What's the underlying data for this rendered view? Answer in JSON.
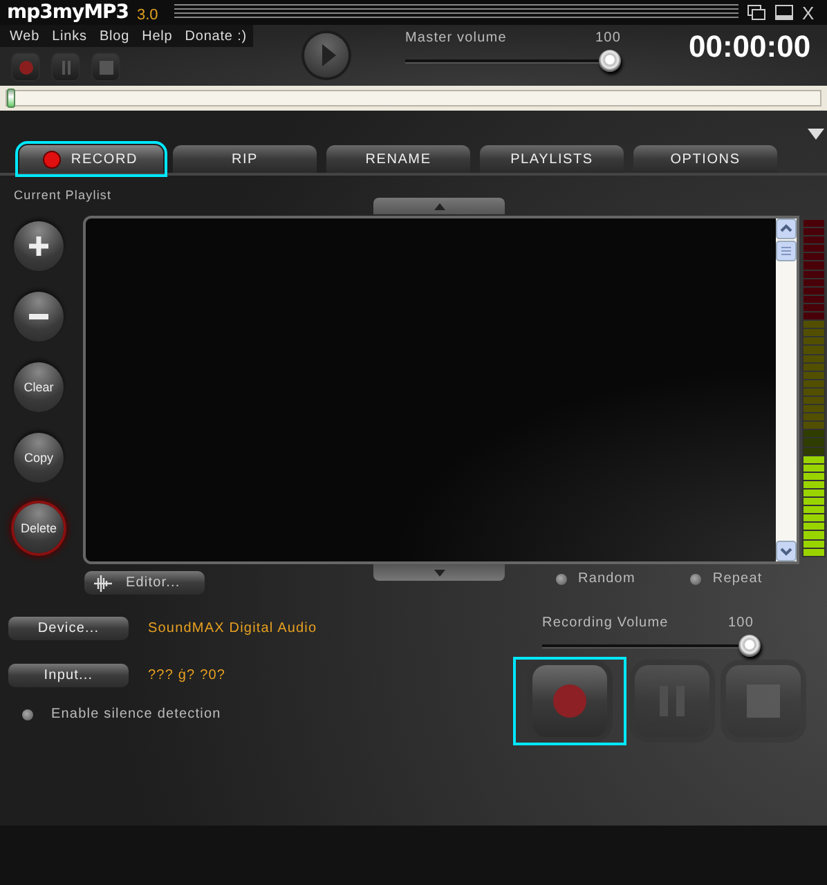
{
  "window": {
    "logo": "mp3myMP3",
    "version": "3.0",
    "close": "X"
  },
  "menu": [
    "Web",
    "Links",
    "Blog",
    "Help",
    "Donate :)"
  ],
  "master_volume": {
    "label": "Master volume",
    "value": "100",
    "level": 1
  },
  "timer": "00:00:00",
  "progress": {
    "level": 0
  },
  "tabs": [
    {
      "label": "RECORD",
      "selected": true,
      "highlighted": true
    },
    {
      "label": "RIP",
      "selected": false,
      "highlighted": false
    },
    {
      "label": "RENAME",
      "selected": false,
      "highlighted": false
    },
    {
      "label": "PLAYLISTS",
      "selected": false,
      "highlighted": false
    },
    {
      "label": "OPTIONS",
      "selected": false,
      "highlighted": false
    }
  ],
  "playlist": {
    "label": "Current Playlist",
    "buttons": [
      {
        "kind": "add",
        "highlighted": false
      },
      {
        "kind": "remove",
        "highlighted": false
      },
      {
        "kind": "text",
        "label": "Clear",
        "highlighted": false
      },
      {
        "kind": "text",
        "label": "Copy",
        "highlighted": false
      },
      {
        "kind": "text",
        "label": "Delete",
        "highlighted": true
      }
    ]
  },
  "meter": {
    "level": 0.3
  },
  "editor_button": "Editor...",
  "options": [
    {
      "label": "Random",
      "checked": false
    },
    {
      "label": "Repeat",
      "checked": false
    }
  ],
  "device": {
    "button": "Device...",
    "value": "SoundMAX Digital Audio"
  },
  "input": {
    "button": "Input...",
    "value": "??? ġ? ?0?"
  },
  "silence_detection": {
    "label": "Enable silence detection",
    "checked": false
  },
  "recording_volume": {
    "label": "Recording Volume",
    "value": "100",
    "level": 1
  },
  "transport": [
    {
      "kind": "record",
      "disabled": false,
      "highlighted": true
    },
    {
      "kind": "pause",
      "disabled": true,
      "highlighted": false
    },
    {
      "kind": "stop",
      "disabled": true,
      "highlighted": false
    }
  ]
}
